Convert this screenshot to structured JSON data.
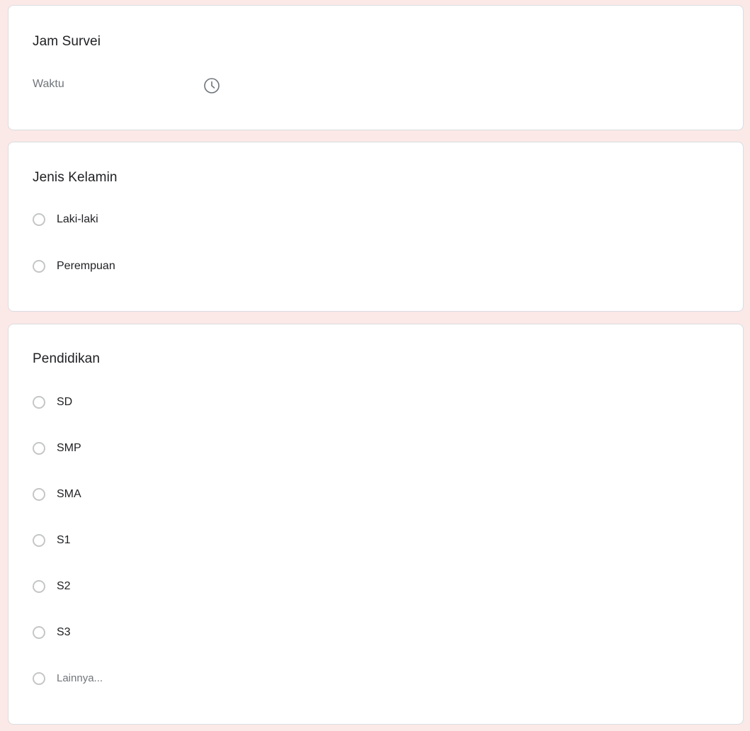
{
  "time_question": {
    "title": "Jam Survei",
    "placeholder": "Waktu",
    "icon": "clock-icon"
  },
  "gender_question": {
    "title": "Jenis Kelamin",
    "options": [
      "Laki-laki",
      "Perempuan"
    ]
  },
  "education_question": {
    "title": "Pendidikan",
    "options": [
      "SD",
      "SMP",
      "SMA",
      "S1",
      "S2",
      "S3",
      "Lainnya..."
    ]
  },
  "colors": {
    "page_background": "#fbe9e7",
    "card_background": "#ffffff",
    "radio_border": "#c4c7c5"
  }
}
